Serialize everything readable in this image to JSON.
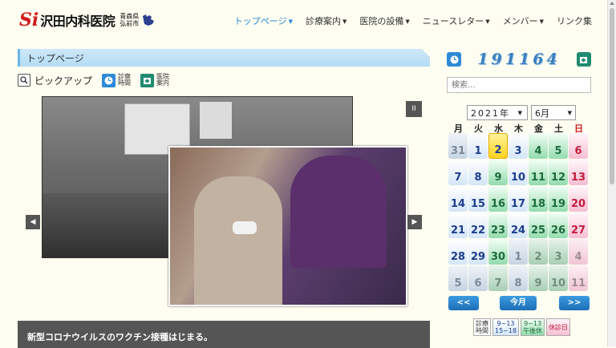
{
  "header": {
    "logo_mark": "Si",
    "logo_name": "沢田内科医院",
    "logo_pref": "青森県",
    "logo_city": "弘前市"
  },
  "nav": [
    {
      "label": "トップページ",
      "active": true,
      "dropdown": true
    },
    {
      "label": "診療案内",
      "active": false,
      "dropdown": true
    },
    {
      "label": "医院の設備",
      "active": false,
      "dropdown": true
    },
    {
      "label": "ニュースレター",
      "active": false,
      "dropdown": true
    },
    {
      "label": "メンバー",
      "active": false,
      "dropdown": true
    },
    {
      "label": "リンク集",
      "active": false,
      "dropdown": false
    }
  ],
  "main": {
    "section_title": "トップページ",
    "pickup_label": "ピックアップ",
    "links": [
      {
        "line1": "診察",
        "line2": "時間",
        "icon": "clock-icon"
      },
      {
        "line1": "医院",
        "line2": "案内",
        "icon": "clinic-icon"
      }
    ],
    "slider": {
      "pause_label": "II",
      "prev_label": "◀",
      "next_label": "▶"
    },
    "news_title": "新型コロナウイルスのワクチン接種はじまる。"
  },
  "sidebar": {
    "counter": "191164",
    "search_placeholder": "検索...",
    "calendar": {
      "year": "2021年",
      "month": "6月",
      "weekdays": [
        "月",
        "火",
        "水",
        "木",
        "金",
        "土",
        "日"
      ],
      "cells": [
        {
          "d": "31",
          "t": "ow"
        },
        {
          "d": "1",
          "t": "w"
        },
        {
          "d": "2",
          "t": "t"
        },
        {
          "d": "3",
          "t": "w"
        },
        {
          "d": "4",
          "t": "h"
        },
        {
          "d": "5",
          "t": "h"
        },
        {
          "d": "6",
          "t": "x"
        },
        {
          "d": "7",
          "t": "w"
        },
        {
          "d": "8",
          "t": "w"
        },
        {
          "d": "9",
          "t": "h"
        },
        {
          "d": "10",
          "t": "w"
        },
        {
          "d": "11",
          "t": "h"
        },
        {
          "d": "12",
          "t": "h"
        },
        {
          "d": "13",
          "t": "x"
        },
        {
          "d": "14",
          "t": "w"
        },
        {
          "d": "15",
          "t": "w"
        },
        {
          "d": "16",
          "t": "h"
        },
        {
          "d": "17",
          "t": "w"
        },
        {
          "d": "18",
          "t": "h"
        },
        {
          "d": "19",
          "t": "h"
        },
        {
          "d": "20",
          "t": "x"
        },
        {
          "d": "21",
          "t": "w"
        },
        {
          "d": "22",
          "t": "w"
        },
        {
          "d": "23",
          "t": "h"
        },
        {
          "d": "24",
          "t": "w"
        },
        {
          "d": "25",
          "t": "h"
        },
        {
          "d": "26",
          "t": "h"
        },
        {
          "d": "27",
          "t": "x"
        },
        {
          "d": "28",
          "t": "w"
        },
        {
          "d": "29",
          "t": "w"
        },
        {
          "d": "30",
          "t": "h"
        },
        {
          "d": "1",
          "t": "ow"
        },
        {
          "d": "2",
          "t": "oh"
        },
        {
          "d": "3",
          "t": "oh"
        },
        {
          "d": "4",
          "t": "ox"
        },
        {
          "d": "5",
          "t": "ow"
        },
        {
          "d": "6",
          "t": "ow"
        },
        {
          "d": "7",
          "t": "oh"
        },
        {
          "d": "8",
          "t": "ow"
        },
        {
          "d": "9",
          "t": "oh"
        },
        {
          "d": "10",
          "t": "oh"
        },
        {
          "d": "11",
          "t": "ox"
        }
      ],
      "prev_label": "<<",
      "today_label": "今月",
      "next_label": ">>"
    },
    "legend": {
      "label_line1": "診療",
      "label_line2": "時間",
      "weekday_line1": "9~13",
      "weekday_line2": "15~18",
      "half_line1": "9~13",
      "half_line2": "午後休",
      "closed": "休診日"
    }
  }
}
